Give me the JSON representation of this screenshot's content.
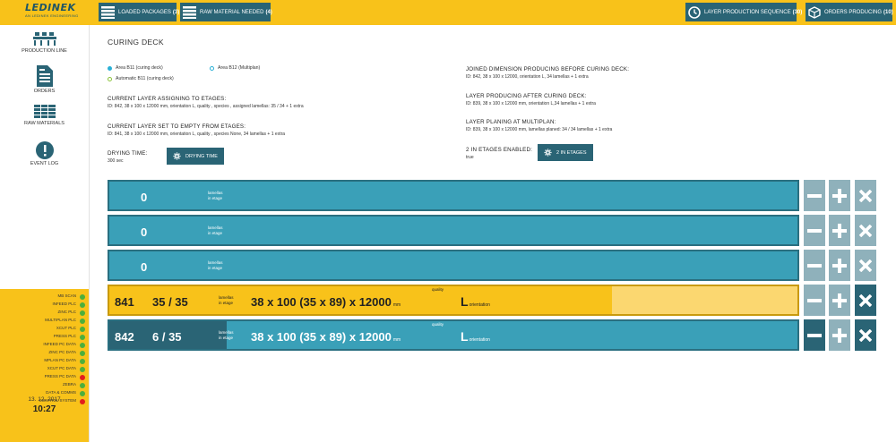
{
  "header": {
    "brand": "LEDINEK",
    "brand_sub": "AN LEDINEK ENGINEERING",
    "loaded_packages": {
      "label": "LOADED PACKAGES",
      "count": "(3)"
    },
    "raw_material": {
      "label": "RAW MATERIAL NEEDED",
      "count": "(4)"
    },
    "layer_sequence": {
      "label": "LAYER PRODUCTION SEQUENCE",
      "count": "(30)"
    },
    "orders_producing": {
      "label": "ORDERS PRODUCING",
      "count": "(10)"
    }
  },
  "sidebar": {
    "items": [
      {
        "label": "PRODUCTION LINE",
        "icon": "production-line-icon"
      },
      {
        "label": "ORDERS",
        "icon": "orders-icon"
      },
      {
        "label": "RAW MATERIALS",
        "icon": "raw-materials-icon"
      },
      {
        "label": "EVENT LOG",
        "icon": "event-log-icon"
      }
    ]
  },
  "plc": {
    "items": [
      {
        "label": "MB SCAN",
        "status": "ok"
      },
      {
        "label": "INFEED PLC",
        "status": "ok"
      },
      {
        "label": "ZINC PLC",
        "status": "ok"
      },
      {
        "label": "MULTIPLAN PLC",
        "status": "ok"
      },
      {
        "label": "XCUT PLC",
        "status": "ok"
      },
      {
        "label": "PRESS PLC",
        "status": "ok"
      },
      {
        "label": "INFEED PC DATA",
        "status": "ok"
      },
      {
        "label": "ZINC PC DATA",
        "status": "ok"
      },
      {
        "label": "MPLAN PC DATA",
        "status": "ok"
      },
      {
        "label": "XCUT PC DATA",
        "status": "ok"
      },
      {
        "label": "PRESS PC DATA",
        "status": "err"
      },
      {
        "label": "ZEBRA",
        "status": "ok"
      },
      {
        "label": "DATA & COMMS",
        "status": "ok"
      },
      {
        "label": "CONTROL SYSTEM",
        "status": "err"
      }
    ],
    "date": "13. 12. 2017",
    "time": "10:27"
  },
  "page": {
    "title": "CURING DECK",
    "legend": {
      "area_b11": "Area B11 (curing deck)",
      "area_b12": "Area B12 (Multiplan)",
      "auto_b11": "Automatic B11 (curing deck)"
    },
    "current_assigning": {
      "heading": "CURRENT LAYER ASSIGNING TO ETAGES:",
      "value": "ID: 842, 38 x 100 x 12000 mm, orientation L, quality , species , assigned lamellas: 35 / 34 + 1 extra"
    },
    "current_empty": {
      "heading": "CURRENT LAYER SET TO EMPTY FROM ETAGES:",
      "value": "ID: 841, 38 x 100 x 12000 mm, orientation L, quality , species None, 34 lamellas + 1 extra"
    },
    "drying": {
      "heading": "DRYING TIME:",
      "value": "300 sec",
      "button": "DRYING TIME"
    },
    "joined_dim": {
      "heading": "JOINED DIMENSION PRODUCING BEFORE CURING DECK:",
      "value": "ID: 842, 38 x 100 x 12000, orientation L,  34 lamellas + 1 extra"
    },
    "after_deck": {
      "heading": "LAYER PRODUCING AFTER CURING DECK:",
      "value": "ID: 839, 38 x 100 x 12000 mm, orientation L,34 lamellas + 1 extra"
    },
    "planing": {
      "heading": "LAYER PLANING AT MULTIPLAN:",
      "value": "ID: 839, 38 x 100 x 12000 mm, lamellas planed: 34 / 34 lamellas + 1 extra"
    },
    "two_etages": {
      "heading": "2 IN ETAGES ENABLED:",
      "value": "true",
      "button": "2 IN ETAGES"
    }
  },
  "etages": [
    {
      "kind": "empty",
      "count": "0",
      "caption1": "lamellas",
      "caption2": "in etage"
    },
    {
      "kind": "empty",
      "count": "0",
      "caption1": "lamellas",
      "caption2": "in etage"
    },
    {
      "kind": "empty",
      "count": "0",
      "caption1": "lamellas",
      "caption2": "in etage"
    },
    {
      "kind": "yellow",
      "id": "841",
      "count": "35 / 35",
      "caption1": "lamellas",
      "caption2": "in etage",
      "dim": "38 x 100 (35 x 89) x 12000",
      "unit": "mm",
      "quality_label": "quality",
      "orientation": "L",
      "orientation_label": "orientation",
      "fill_fraction": 0.27
    },
    {
      "kind": "teal",
      "id": "842",
      "count": "6 / 35",
      "caption1": "lamellas",
      "caption2": "in etage",
      "dim": "38 x 100 (35 x 89) x 12000",
      "unit": "mm",
      "quality_label": "quality",
      "orientation": "L",
      "orientation_label": "orientation",
      "fill_fraction": 0.17
    }
  ],
  "colors": {
    "accent": "#f8c21a",
    "primary": "#2a6475",
    "etage": "#3aa0b8",
    "ok": "#4caf3c",
    "err": "#e21d1d"
  }
}
